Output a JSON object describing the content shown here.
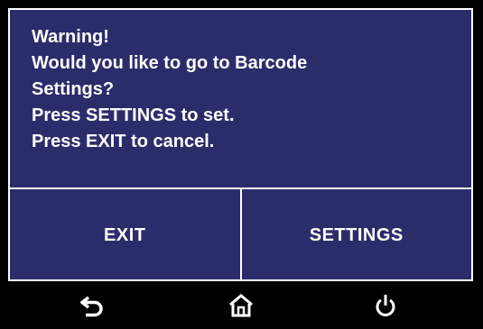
{
  "dialog": {
    "lines": [
      "Warning!",
      "Would you like to go to Barcode",
      "Settings?",
      "Press SETTINGS to set.",
      "Press EXIT to cancel."
    ],
    "exit_label": "EXIT",
    "settings_label": "SETTINGS"
  },
  "navbar": {
    "icons": [
      "back-icon",
      "home-icon",
      "power-icon"
    ]
  },
  "colors": {
    "dialog_background": "#2b2d6b",
    "text": "#ffffff",
    "border": "#ffffff",
    "background": "#000000"
  }
}
